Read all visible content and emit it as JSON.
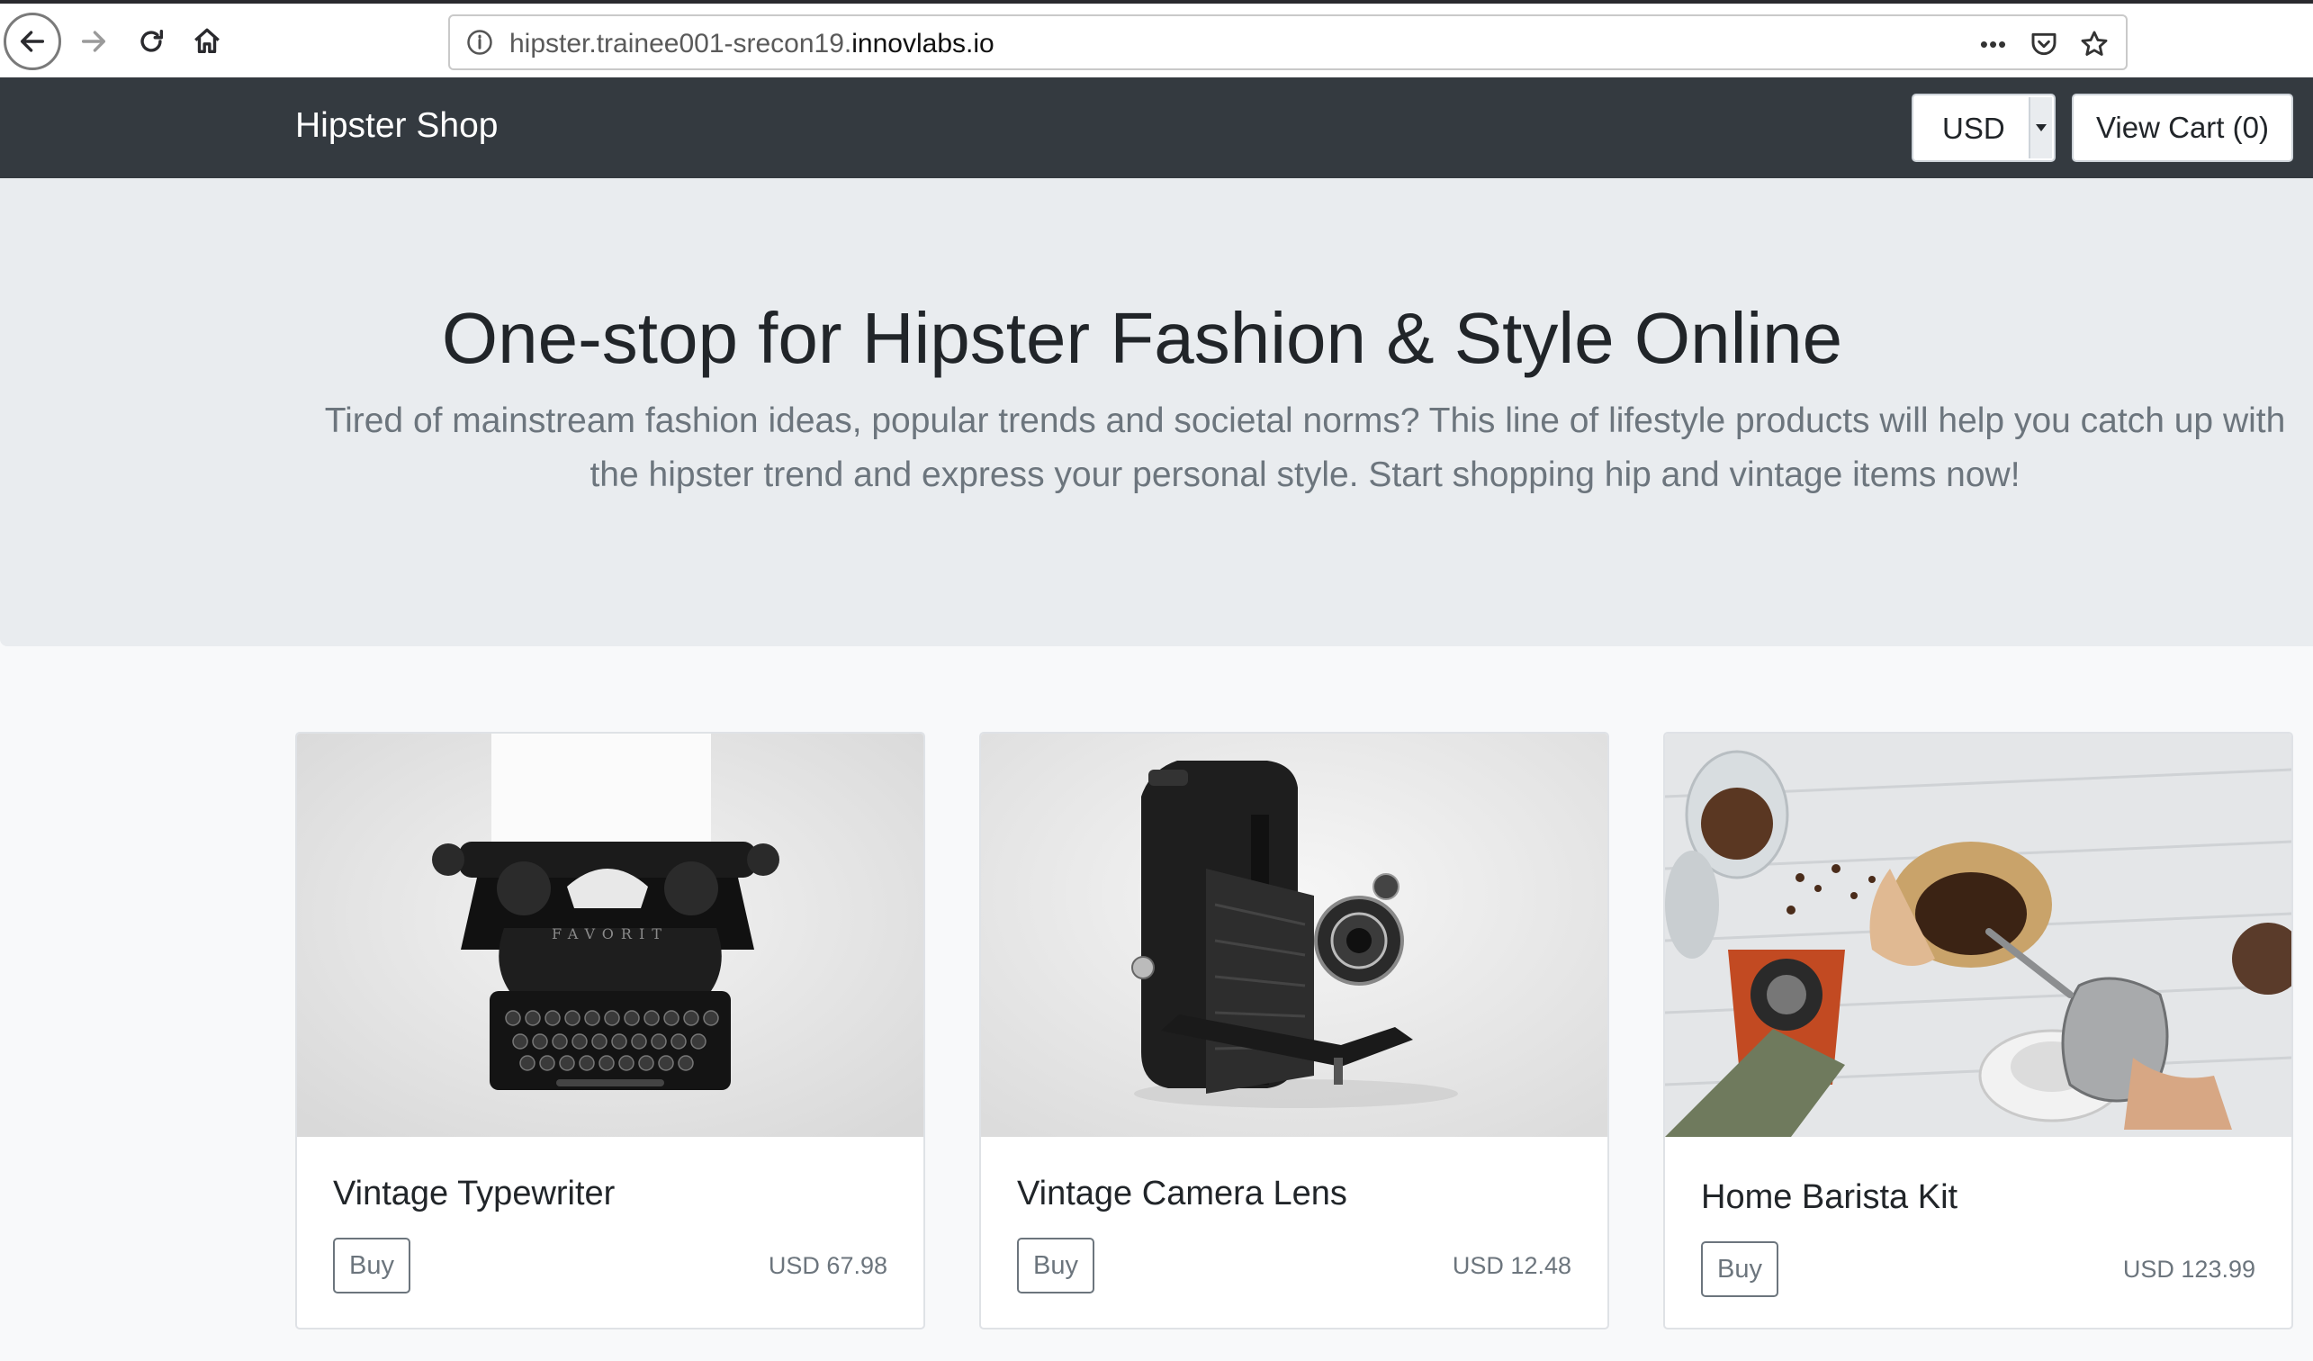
{
  "browser": {
    "url_prefix": "hipster.trainee001-srecon19.",
    "url_domain": "innovlabs.io",
    "page_actions_label": "•••"
  },
  "navbar": {
    "brand": "Hipster Shop",
    "currency": "USD",
    "view_cart": "View Cart (0)"
  },
  "hero": {
    "title": "One-stop for Hipster Fashion & Style Online",
    "subtitle": "Tired of mainstream fashion ideas, popular trends and societal norms? This line of lifestyle products will help you catch up with the hipster trend and express your personal style. Start shopping hip and vintage items now!"
  },
  "products": [
    {
      "name": "Vintage Typewriter",
      "buy_label": "Buy",
      "price": "USD 67.98"
    },
    {
      "name": "Vintage Camera Lens",
      "buy_label": "Buy",
      "price": "USD 12.48"
    },
    {
      "name": "Home Barista Kit",
      "buy_label": "Buy",
      "price": "USD 123.99"
    }
  ],
  "colors": {
    "navbar_bg": "#343a40",
    "jumbotron_bg": "#e9ecef",
    "page_bg": "#f8f9fa",
    "muted_text": "#6c757d"
  }
}
